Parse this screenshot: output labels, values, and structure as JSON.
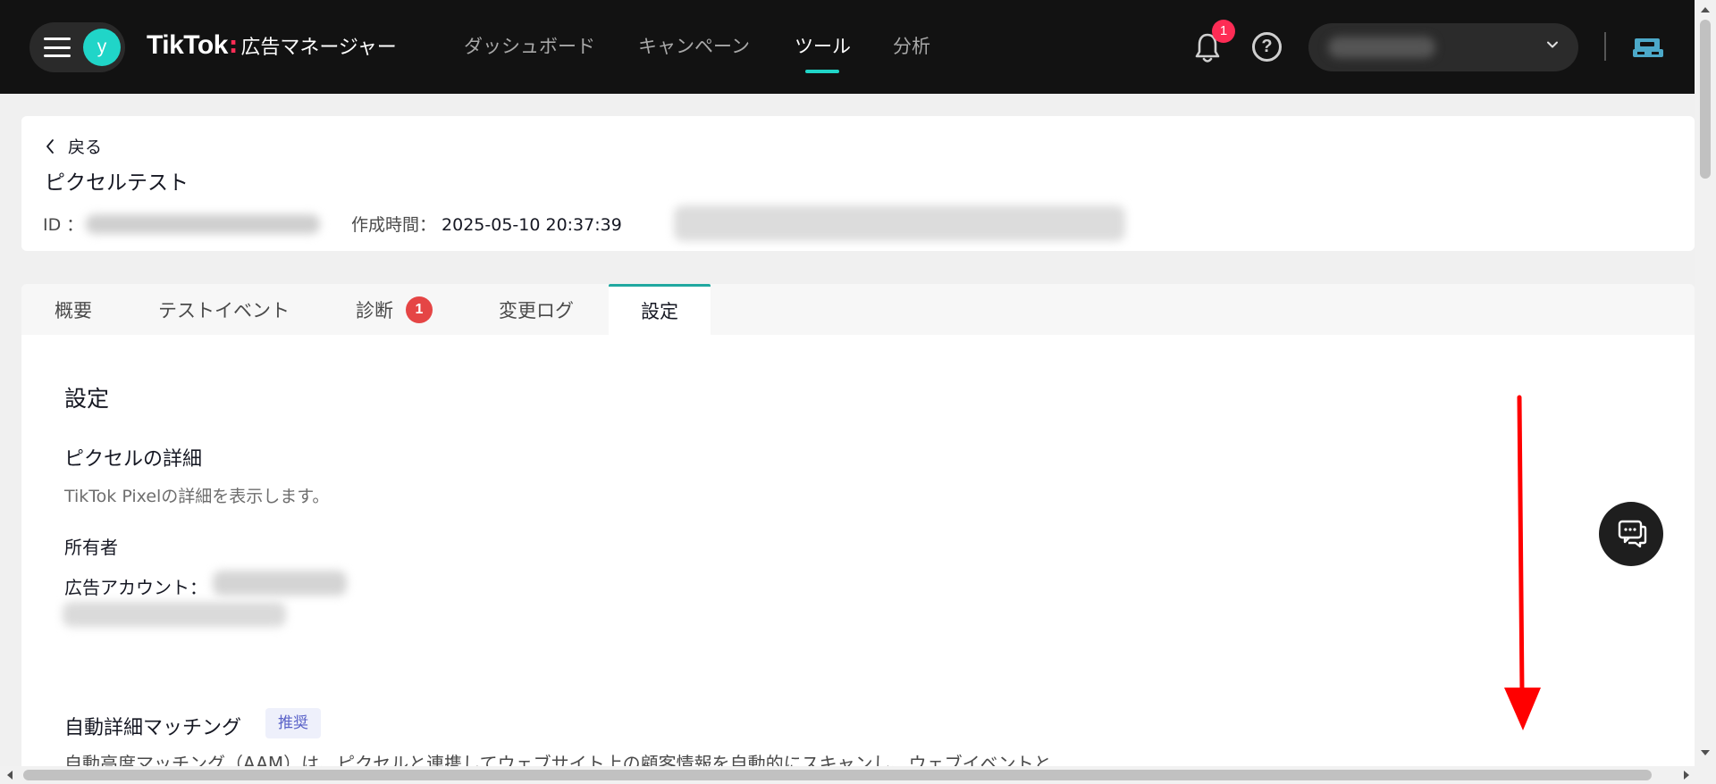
{
  "topbar": {
    "avatar_letter": "y",
    "logo_brand": "TikTok",
    "logo_separator": ":",
    "logo_subtitle": "広告マネージャー",
    "nav": [
      {
        "label": "ダッシュボード",
        "active": false
      },
      {
        "label": "キャンペーン",
        "active": false
      },
      {
        "label": "ツール",
        "active": true
      },
      {
        "label": "分析",
        "active": false
      }
    ],
    "notification_count": "1",
    "help_symbol": "?",
    "accent_color": "#20d5c8",
    "badge_color": "#fe2c55"
  },
  "header": {
    "back_label": "戻る",
    "title": "ピクセルテスト",
    "id_label": "ID ：",
    "created_label": "作成時間：",
    "created_value": "2025-05-10 20:37:39"
  },
  "tabs": [
    {
      "label": "概要",
      "active": false
    },
    {
      "label": "テストイベント",
      "active": false
    },
    {
      "label": "診断",
      "active": false,
      "badge": "1"
    },
    {
      "label": "変更ログ",
      "active": false
    },
    {
      "label": "設定",
      "active": true
    }
  ],
  "settings": {
    "section_title": "設定",
    "pixel_details_title": "ピクセルの詳細",
    "pixel_details_desc": "TikTok Pixelの詳細を表示します。",
    "owner_label": "所有者",
    "ad_account_label": "広告アカウント：",
    "aam_title": "自動詳細マッチング",
    "aam_badge": "推奨",
    "aam_desc": "自動高度マッチング（AAM）は、ピクセルと連携してウェブサイト上の顧客情報を自動的にスキャンし、ウェブイベントと"
  },
  "annotation": {
    "arrow_color": "#ff0000"
  }
}
